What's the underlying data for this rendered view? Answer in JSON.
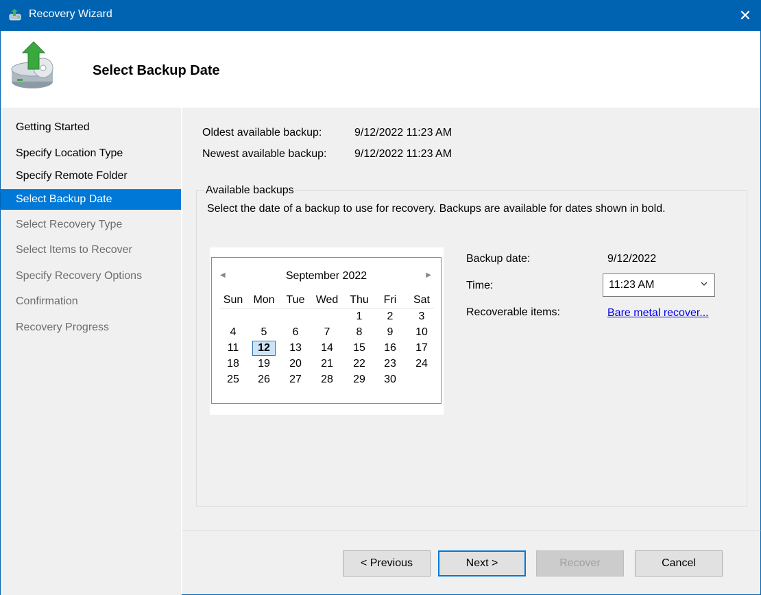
{
  "window": {
    "title": "Recovery Wizard",
    "close_glyph": "✕",
    "app_icon": "backup-wizard-icon"
  },
  "header": {
    "title": "Select Backup Date",
    "icon": "disk-restore-icon"
  },
  "sidebar": {
    "items": [
      {
        "label": "Getting Started",
        "state": "done"
      },
      {
        "label": "Specify Location Type",
        "state": "done"
      },
      {
        "label": "Specify Remote Folder",
        "state": "done"
      },
      {
        "label": "Select Backup Date",
        "state": "selected"
      },
      {
        "label": "Select Recovery Type",
        "state": "disabled"
      },
      {
        "label": "Select Items to Recover",
        "state": "disabled"
      },
      {
        "label": "Specify Recovery Options",
        "state": "disabled"
      },
      {
        "label": "Confirmation",
        "state": "disabled"
      },
      {
        "label": "Recovery Progress",
        "state": "disabled"
      }
    ]
  },
  "info": {
    "oldest_label": "Oldest available backup:",
    "oldest_value": "9/12/2022 11:23 AM",
    "newest_label": "Newest available backup:",
    "newest_value": "9/12/2022 11:23 AM"
  },
  "backups": {
    "group_title": "Available backups",
    "description": "Select the date of a backup to use for recovery. Backups are available for dates shown in bold."
  },
  "calendar": {
    "month_label": "September 2022",
    "prev_glyph": "◀",
    "next_glyph": "▶",
    "weekdays": [
      "Sun",
      "Mon",
      "Tue",
      "Wed",
      "Thu",
      "Fri",
      "Sat"
    ],
    "first_weekday_index": 4,
    "days_in_month": 30,
    "today": 12,
    "bold_dates": [
      12
    ]
  },
  "details": {
    "backup_date_label": "Backup date:",
    "backup_date_value": "9/12/2022",
    "time_label": "Time:",
    "time_value": "11:23 AM",
    "recoverable_label": "Recoverable items:",
    "recoverable_link": "Bare metal recover..."
  },
  "buttons": {
    "previous": "< Previous",
    "next": "Next >",
    "recover": "Recover",
    "cancel": "Cancel"
  },
  "colors": {
    "titlebar": "#0063b1",
    "selection": "#0078d7",
    "link": "#0000ee"
  }
}
